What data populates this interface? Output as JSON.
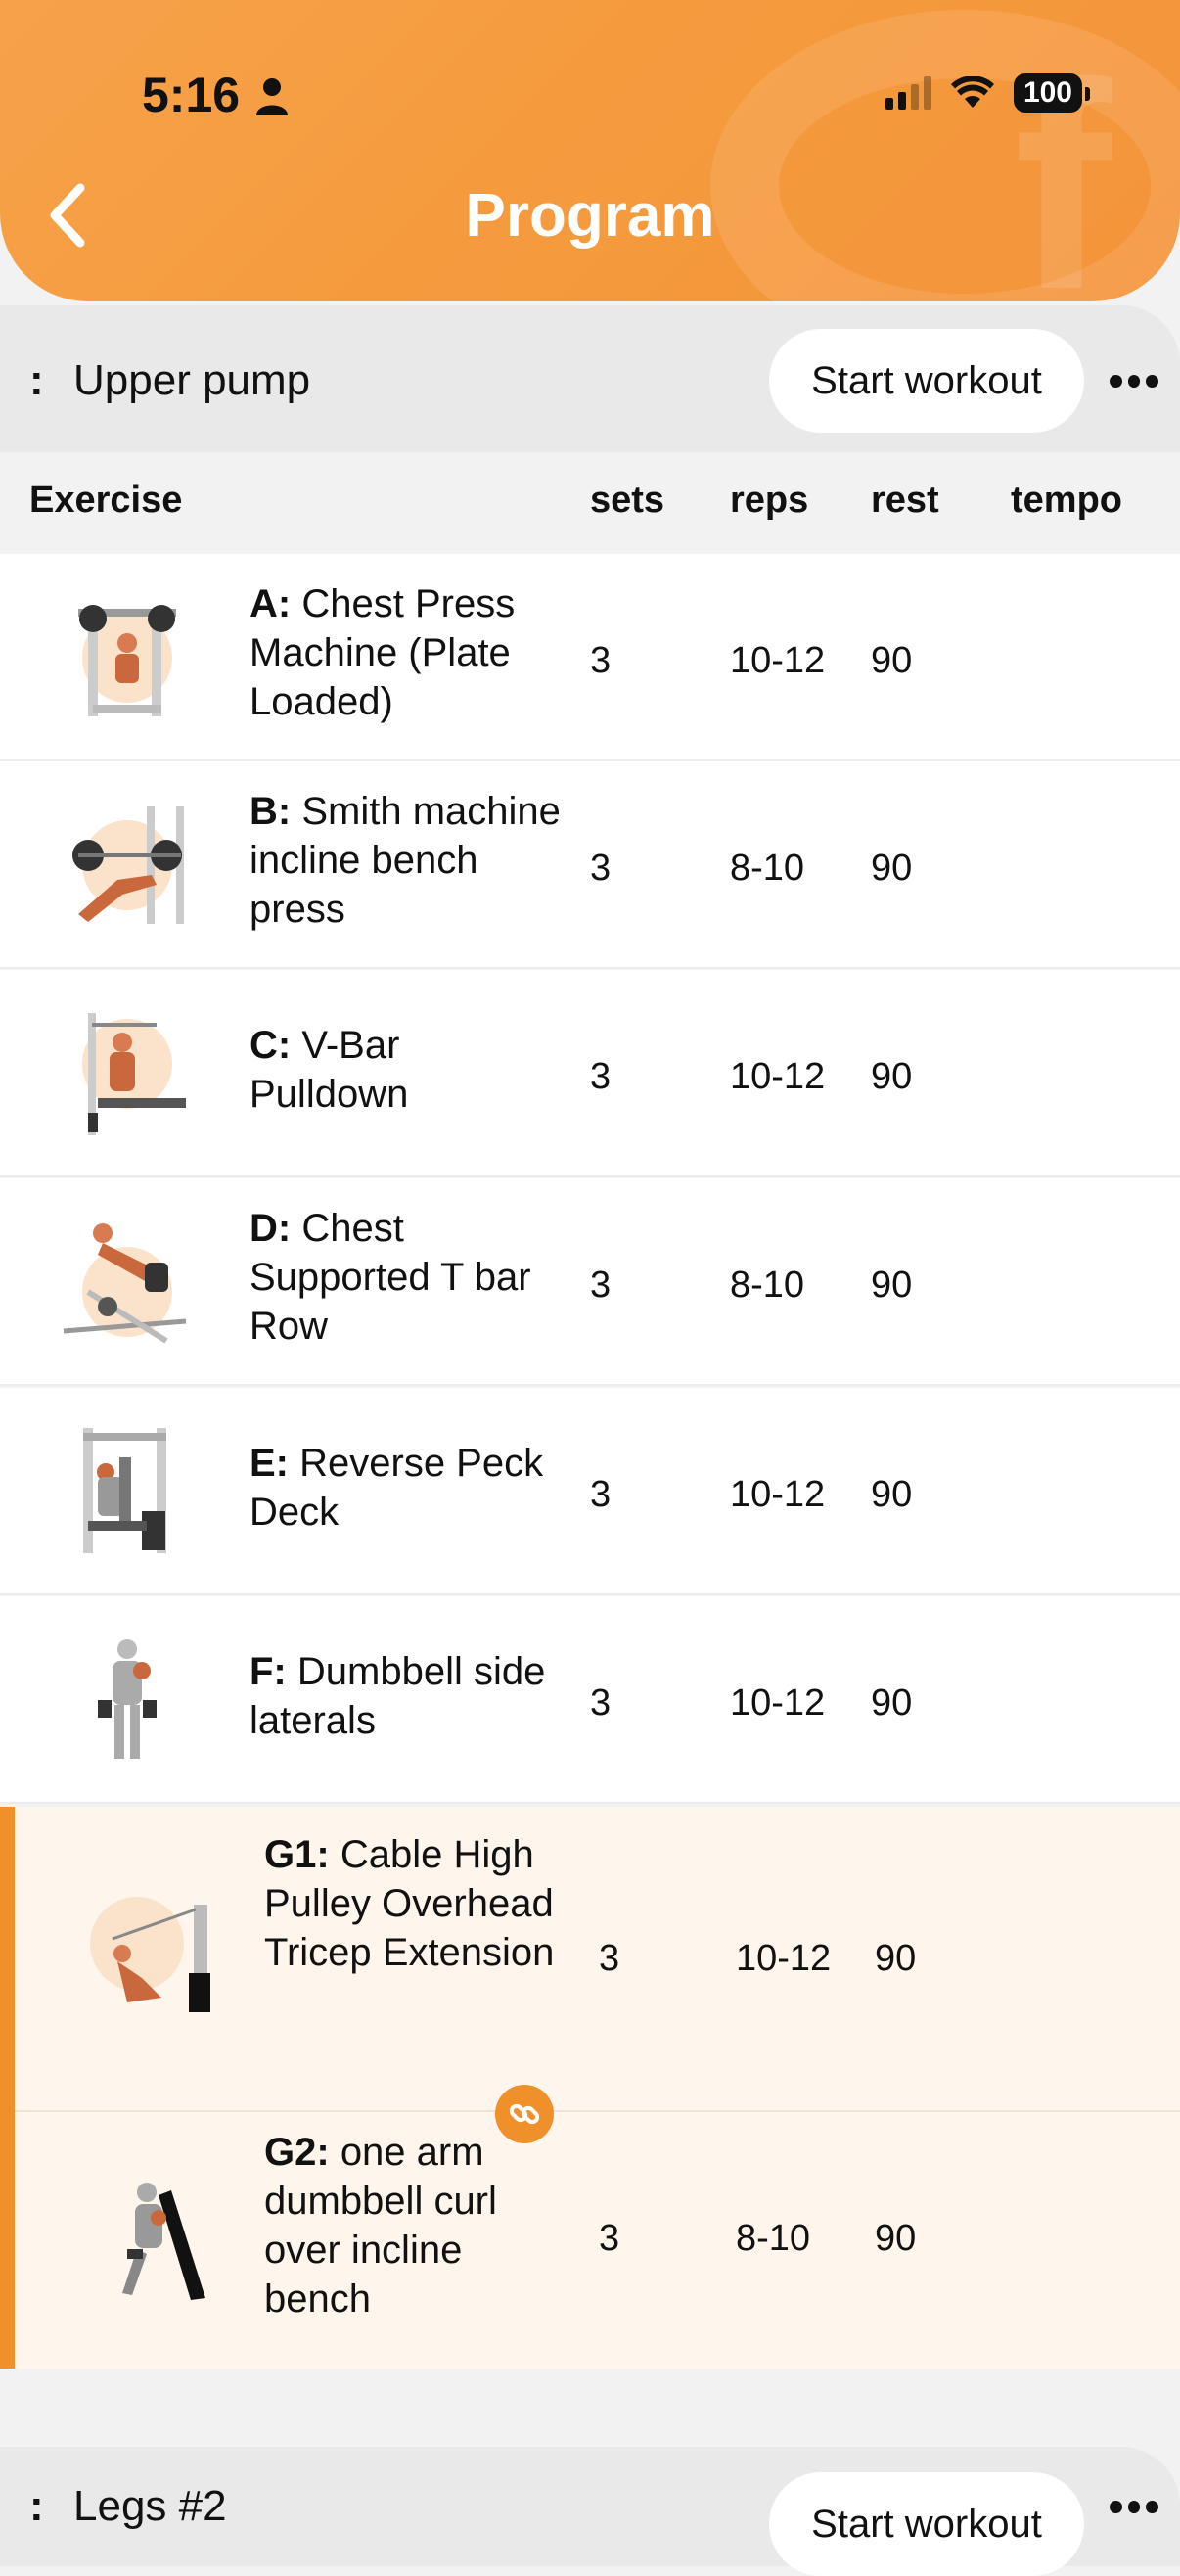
{
  "status": {
    "time": "5:16",
    "battery": "100"
  },
  "nav": {
    "title": "Program"
  },
  "sections": [
    {
      "handle": ":",
      "title": "Upper pump",
      "start_label": "Start workout"
    },
    {
      "handle": ":",
      "title": "Legs #2",
      "start_label": "Start workout"
    }
  ],
  "columns": {
    "exercise": "Exercise",
    "sets": "sets",
    "reps": "reps",
    "rest": "rest",
    "tempo": "tempo"
  },
  "exercises": [
    {
      "code": "A:",
      "name": "Chest Press Machine (Plate Loaded)",
      "sets": "3",
      "reps": "10-12",
      "rest": "90",
      "tempo": ""
    },
    {
      "code": "B:",
      "name": "Smith machine incline bench press",
      "sets": "3",
      "reps": "8-10",
      "rest": "90",
      "tempo": ""
    },
    {
      "code": "C:",
      "name": " V-Bar Pulldown",
      "sets": "3",
      "reps": "10-12",
      "rest": "90",
      "tempo": ""
    },
    {
      "code": "D:",
      "name": "Chest Supported T bar Row",
      "sets": "3",
      "reps": "8-10",
      "rest": "90",
      "tempo": ""
    },
    {
      "code": "E:",
      "name": "Reverse Peck Deck",
      "sets": "3",
      "reps": "10-12",
      "rest": "90",
      "tempo": ""
    },
    {
      "code": "F:",
      "name": "Dumbbell side laterals",
      "sets": "3",
      "reps": "10-12",
      "rest": "90",
      "tempo": ""
    }
  ],
  "superset": [
    {
      "code": "G1:",
      "name": "Cable High Pulley Overhead Tricep Extension",
      "sets": "3",
      "reps": "10-12",
      "rest": "90",
      "tempo": ""
    },
    {
      "code": "G2:",
      "name": "one arm dumbbell curl over incline bench",
      "sets": "3",
      "reps": "8-10",
      "rest": "90",
      "tempo": ""
    }
  ],
  "colors": {
    "accent": "#f0902a",
    "header": "#f59b3e",
    "superset_bg": "#fef5ec"
  },
  "icons": {
    "back": "chevron-left-icon",
    "more": "ellipsis-icon",
    "link": "link-icon",
    "person": "person-icon"
  }
}
